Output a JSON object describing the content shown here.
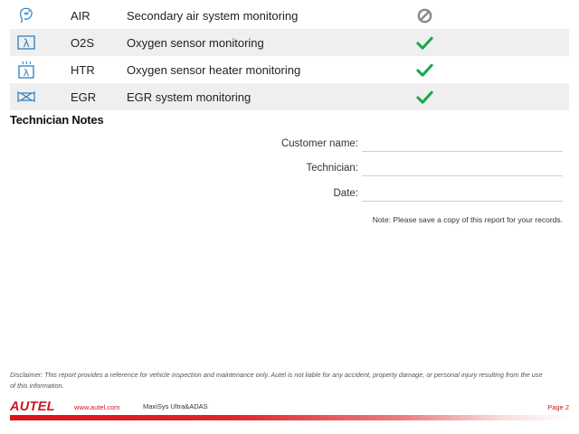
{
  "monitors": [
    {
      "code": "AIR",
      "description": "Secondary air system monitoring",
      "icon": "secondary-air-icon",
      "status": "not-supported"
    },
    {
      "code": "O2S",
      "description": "Oxygen sensor monitoring",
      "icon": "oxygen-sensor-icon",
      "status": "complete"
    },
    {
      "code": "HTR",
      "description": "Oxygen sensor heater monitoring",
      "icon": "oxygen-heater-icon",
      "status": "complete"
    },
    {
      "code": "EGR",
      "description": "EGR system monitoring",
      "icon": "egr-icon",
      "status": "complete"
    }
  ],
  "technician_notes": {
    "title": "Technician Notes",
    "customer_label": "Customer name:",
    "technician_label": "Technician:",
    "date_label": "Date:",
    "note": "Note: Please save a copy of this report for your records."
  },
  "disclaimer": "Disclaimer: This report provides a reference for vehicle inspection and maintenance only. Autel is not liable for any accident, property damage, or personal injury resulting from the use of this information.",
  "footer": {
    "logo_text": "AUTEL",
    "website": "www.autel.com",
    "product": "MaxiSys Ultra&ADAS",
    "page": "Page 2"
  },
  "colors": {
    "brand_red": "#d0161f",
    "check_green": "#1aa84a",
    "not_supported_grey": "#8a8a8a",
    "icon_blue": "#2a7fc1"
  }
}
